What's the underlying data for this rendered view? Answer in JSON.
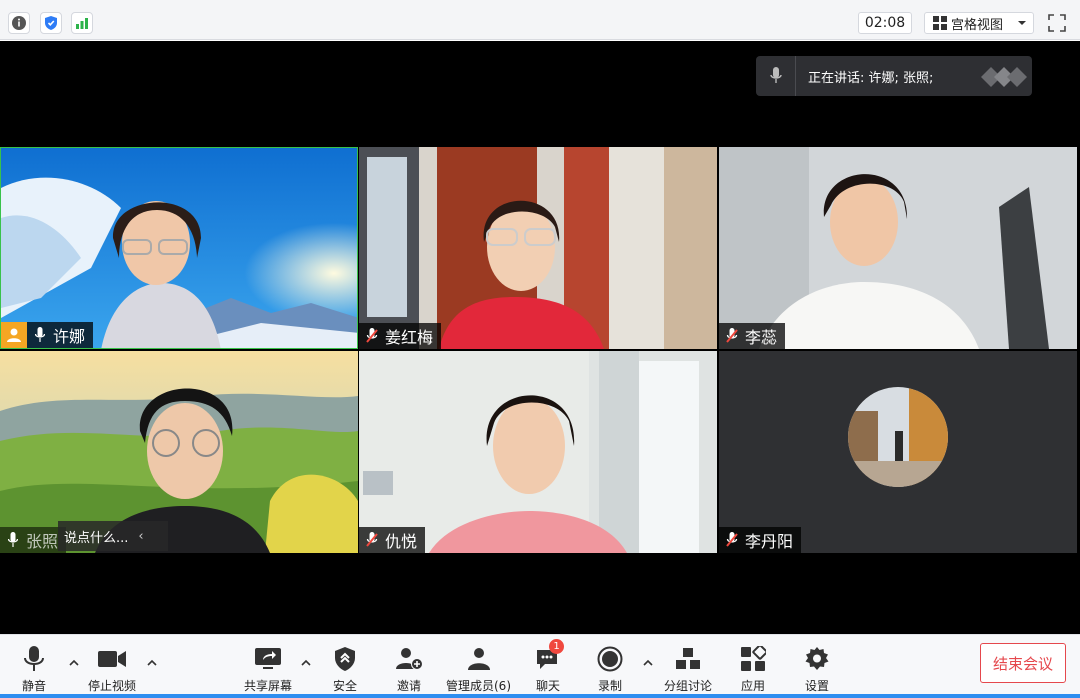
{
  "topbar": {
    "timer": "02:08",
    "view_label": "宫格视图",
    "icons": [
      "info-icon",
      "shield-icon",
      "signal-icon",
      "grid-icon",
      "chevron-down-icon",
      "fullscreen-icon"
    ]
  },
  "speaking": {
    "text": "正在讲话: 许娜; 张照;"
  },
  "tiles": [
    {
      "name": "许娜",
      "is_host": true,
      "muted": false
    },
    {
      "name": "姜红梅",
      "is_host": false,
      "muted": true
    },
    {
      "name": "李蕊",
      "is_host": false,
      "muted": true
    },
    {
      "name": "张照",
      "is_host": false,
      "muted": false,
      "chat_preview": "说点什么..."
    },
    {
      "name": "仇悦",
      "is_host": false,
      "muted": true
    },
    {
      "name": "李丹阳",
      "is_host": false,
      "muted": true,
      "video_off": true
    }
  ],
  "toolbar": {
    "mute_label": "静音",
    "stop_video_label": "停止视频",
    "share_label": "共享屏幕",
    "security_label": "安全",
    "invite_label": "邀请",
    "members_label": "管理成员(6)",
    "chat_label": "聊天",
    "chat_badge": "1",
    "record_label": "录制",
    "breakout_label": "分组讨论",
    "apps_label": "应用",
    "settings_label": "设置",
    "end_label": "结束会议"
  },
  "colors": {
    "accent": "#2e8ef0",
    "end_red": "#e5484d",
    "host_orange": "#f5a623",
    "stage_bg": "#000000",
    "speaking_bg": "#2e2f33"
  }
}
